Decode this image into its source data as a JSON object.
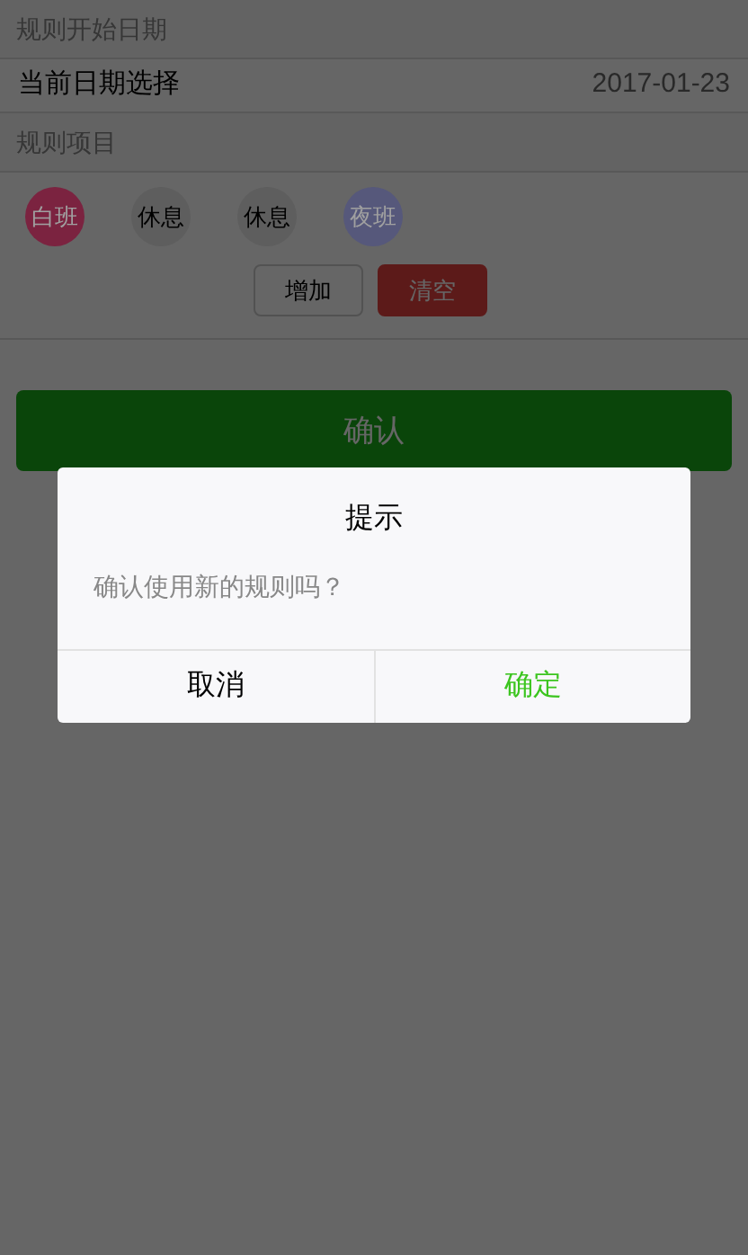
{
  "start_section": {
    "title": "规则开始日期"
  },
  "date_row": {
    "label": "当前日期选择",
    "value": "2017-01-23"
  },
  "rule_section": {
    "title": "规则项目"
  },
  "rule_items": [
    {
      "label": "白班",
      "color": "#7b2340"
    },
    {
      "label": "休息",
      "color": "#5e5e5e"
    },
    {
      "label": "休息",
      "color": "#5e5e5e"
    },
    {
      "label": "夜班",
      "color": "#56587b"
    }
  ],
  "actions": [
    {
      "label": "增加",
      "kind": "default"
    },
    {
      "label": "清空",
      "kind": "warn"
    }
  ],
  "confirm_button": {
    "label": "确认"
  },
  "dialog": {
    "title": "提示",
    "message": "确认使用新的规则吗？",
    "cancel": "取消",
    "ok": "确定"
  }
}
